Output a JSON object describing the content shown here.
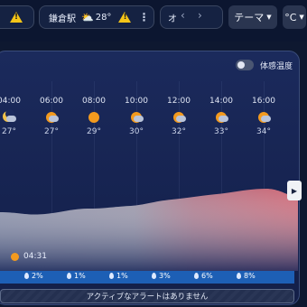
{
  "top": {
    "location_chip": {
      "location": "鎌倉駅",
      "temp": "28°"
    },
    "third_chip_text": "オ",
    "nav_prev": "‹",
    "nav_next": "›",
    "theme_label": "テーマ",
    "unit_label": "°C",
    "colors": {
      "warning": "#f5c518"
    }
  },
  "panel": {
    "feels_like_label": "体感温度",
    "feels_like_on": false,
    "hours": [
      {
        "time": "04:00",
        "temp": "27°",
        "icon": "moon-cloud-icon"
      },
      {
        "time": "06:00",
        "temp": "27°",
        "icon": "sun-cloud-icon"
      },
      {
        "time": "08:00",
        "temp": "29°",
        "icon": "sun-icon"
      },
      {
        "time": "10:00",
        "temp": "30°",
        "icon": "sun-cloud-icon"
      },
      {
        "time": "12:00",
        "temp": "32°",
        "icon": "sun-cloud-icon"
      },
      {
        "time": "14:00",
        "temp": "33°",
        "icon": "sun-cloud-icon"
      },
      {
        "time": "16:00",
        "temp": "34°",
        "icon": "sun-cloud-icon"
      }
    ],
    "sunrise_time": "04:31",
    "precip": [
      "2%",
      "1%",
      "1%",
      "3%",
      "6%",
      "8%"
    ],
    "alert_text": "アクティブなアラートはありません",
    "side_arrow": "▶"
  }
}
